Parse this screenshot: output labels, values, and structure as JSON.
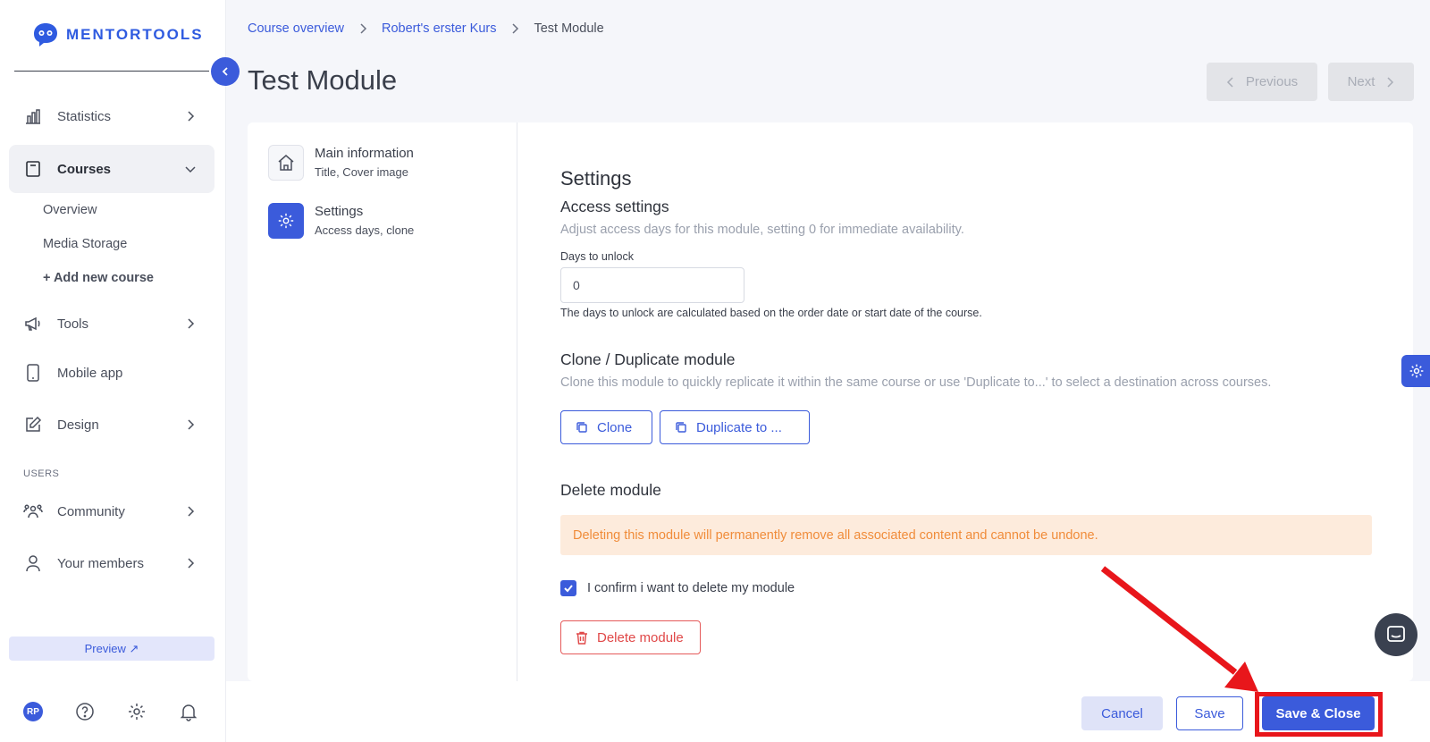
{
  "brand": {
    "name": "MENTORTOOLS",
    "accent": "#3b5bdb"
  },
  "sidebar": {
    "items": [
      {
        "label": "Statistics",
        "icon": "bar-chart-icon"
      },
      {
        "label": "Courses",
        "icon": "book-icon",
        "active": true
      },
      {
        "label": "Tools",
        "icon": "megaphone-icon"
      },
      {
        "label": "Mobile app",
        "icon": "mobile-icon"
      },
      {
        "label": "Design",
        "icon": "pen-icon"
      },
      {
        "label": "Community",
        "icon": "community-icon"
      },
      {
        "label": "Your members",
        "icon": "user-icon"
      }
    ],
    "course_sub": [
      "Overview",
      "Media Storage",
      "+ Add new course"
    ],
    "section_users": "USERS",
    "preview_label": "Preview ↗",
    "avatar_initials": "RP"
  },
  "breadcrumb": [
    "Course overview",
    "Robert's erster Kurs",
    "Test Module"
  ],
  "page_title": "Test Module",
  "pager": {
    "previous": "Previous",
    "next": "Next"
  },
  "steps": [
    {
      "title": "Main information",
      "subtitle": "Title, Cover image",
      "icon": "home-icon"
    },
    {
      "title": "Settings",
      "subtitle": "Access days, clone",
      "icon": "gear-icon",
      "active": true
    }
  ],
  "settings": {
    "heading": "Settings",
    "access": {
      "title": "Access settings",
      "description": "Adjust access days for this module, setting 0 for immediate availability.",
      "field_label": "Days to unlock",
      "field_value": "0",
      "help": "The days to unlock are calculated based on the order date or start date of the course."
    },
    "clone": {
      "title": "Clone / Duplicate module",
      "description": "Clone this module to quickly replicate it within the same course or use 'Duplicate to...' to select a destination across courses.",
      "clone_label": "Clone",
      "duplicate_label": "Duplicate to ..."
    },
    "delete": {
      "title": "Delete module",
      "warning": "Deleting this module will permanently remove all associated content and cannot be undone.",
      "confirm_label": "I confirm i want to delete my module",
      "confirm_checked": true,
      "button_label": "Delete module"
    }
  },
  "footer": {
    "cancel": "Cancel",
    "save": "Save",
    "save_close": "Save & Close"
  },
  "annotation_color": "#e8161b"
}
